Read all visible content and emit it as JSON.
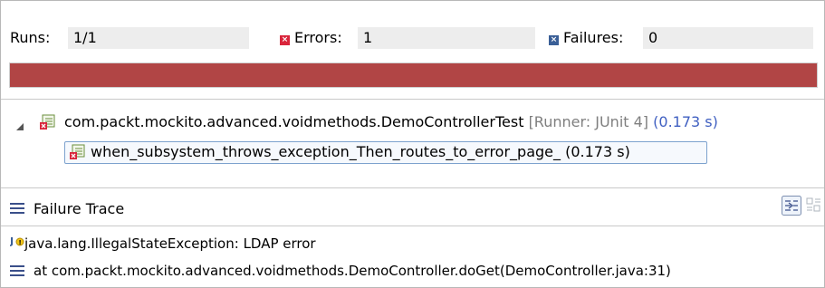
{
  "stats": {
    "runs_label": "Runs:",
    "runs_value": "1/1",
    "errors_label": "Errors:",
    "errors_value": "1",
    "failures_label": "Failures:",
    "failures_value": "0"
  },
  "progress": {
    "fraction": 1.0,
    "color": "#b14545"
  },
  "tree": {
    "suite": {
      "icon": "test-suite-error-icon",
      "name": "com.packt.mockito.advanced.voidmethods.DemoControllerTest",
      "runner": "[Runner: JUnit 4]",
      "time": "(0.173 s)"
    },
    "case": {
      "icon": "test-case-error-icon",
      "name": "when_subsystem_throws_exception_Then_routes_to_error_page_",
      "time": "(0.173 s)"
    }
  },
  "failure_trace": {
    "title": "Failure Trace",
    "icon": "stack-trace-icon",
    "filter_icon": "filter-stack-icon",
    "compare_icon": "compare-result-icon",
    "lines": [
      {
        "icon": "exception-icon",
        "text": "java.lang.IllegalStateException: LDAP error"
      },
      {
        "icon": "stack-frame-icon",
        "text": "at com.packt.mockito.advanced.voidmethods.DemoController.doGet(DemoController.java:31)"
      }
    ]
  },
  "colors": {
    "error": "#d9253b",
    "failure": "#3a5f97",
    "runner_text": "#7f7f7f",
    "time_text": "#3f5fc1"
  }
}
